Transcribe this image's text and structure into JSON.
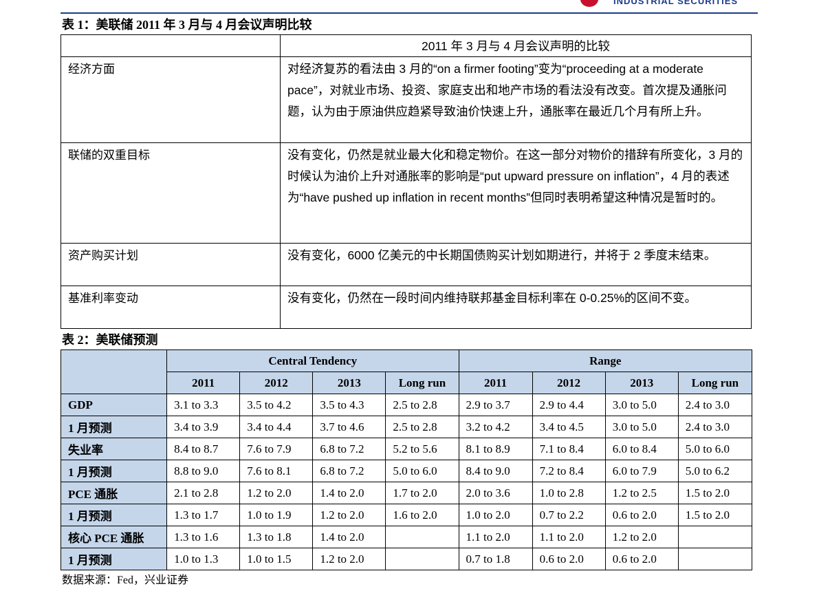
{
  "header": {
    "logo_text": "INDUSTRIAL SECURITIES"
  },
  "table1": {
    "caption": "表 1：美联储 2011 年 3 月与 4 月会议声明比较",
    "header": "2011 年 3 月与 4 月会议声明的比较",
    "rows": [
      {
        "category": "经济方面",
        "text": "对经济复苏的看法由 3 月的“on a firmer footing”变为“proceeding at a moderate pace”，对就业市场、投资、家庭支出和地产市场的看法没有改变。首次提及通胀问题，认为由于原油供应趋紧导致油价快速上升，通胀率在最近几个月有所上升。"
      },
      {
        "category": "联储的双重目标",
        "text": "没有变化，仍然是就业最大化和稳定物价。在这一部分对物价的措辞有所变化，3 月的时候认为油价上升对通胀率的影响是“put upward pressure on inflation”，4 月的表述为“have pushed up inflation in recent months”但同时表明希望这种情况是暂时的。"
      },
      {
        "category": "资产购买计划",
        "text": "没有变化，6000 亿美元的中长期国债购买计划如期进行，并将于 2 季度末结束。"
      },
      {
        "category": "基准利率变动",
        "text": "没有变化，仍然在一段时间内维持联邦基金目标利率在 0-0.25%的区间不变。"
      }
    ]
  },
  "table2": {
    "caption": "表 2：美联储预测",
    "groups": [
      "Central Tendency",
      "Range"
    ],
    "years": [
      "2011",
      "2012",
      "2013",
      "Long run",
      "2011",
      "2012",
      "2013",
      "Long run"
    ],
    "rows": [
      {
        "label": "GDP",
        "values": [
          "3.1 to 3.3",
          "3.5 to 4.2",
          "3.5 to 4.3",
          "2.5 to 2.8",
          "2.9 to 3.7",
          "2.9 to 4.4",
          "3.0 to 5.0",
          "2.4 to 3.0"
        ]
      },
      {
        "label": "1 月预测",
        "values": [
          "3.4 to 3.9",
          "3.4 to 4.4",
          "3.7 to 4.6",
          "2.5 to 2.8",
          "3.2 to 4.2",
          "3.4 to 4.5",
          "3.0 to 5.0",
          "2.4 to 3.0"
        ]
      },
      {
        "label": "失业率",
        "values": [
          "8.4 to 8.7",
          "7.6 to 7.9",
          "6.8 to 7.2",
          "5.2 to 5.6",
          "8.1 to 8.9",
          "7.1 to 8.4",
          "6.0 to 8.4",
          "5.0 to 6.0"
        ]
      },
      {
        "label": "1 月预测",
        "values": [
          "8.8 to 9.0",
          "7.6 to 8.1",
          "6.8 to 7.2",
          "5.0 to 6.0",
          "8.4 to 9.0",
          "7.2 to 8.4",
          "6.0 to 7.9",
          "5.0 to 6.2"
        ]
      },
      {
        "label": "PCE 通胀",
        "values": [
          "2.1 to 2.8",
          "1.2 to 2.0",
          "1.4 to 2.0",
          "1.7 to 2.0",
          "2.0 to 3.6",
          "1.0 to 2.8",
          "1.2 to 2.5",
          "1.5 to 2.0"
        ]
      },
      {
        "label": "1 月预测",
        "values": [
          "1.3 to 1.7",
          "1.0 to 1.9",
          "1.2 to 2.0",
          "1.6 to 2.0",
          "1.0 to 2.0",
          "0.7 to 2.2",
          "0.6 to 2.0",
          "1.5 to 2.0"
        ]
      },
      {
        "label": "核心 PCE 通胀",
        "values": [
          "1.3 to 1.6",
          "1.3 to 1.8",
          "1.4 to 2.0",
          "",
          "1.1 to 2.0",
          "1.1 to 2.0",
          "1.2 to 2.0",
          ""
        ]
      },
      {
        "label": "1 月预测",
        "values": [
          "1.0 to 1.3",
          "1.0 to 1.5",
          "1.2 to 2.0",
          "",
          "0.7 to 1.8",
          "0.6 to 2.0",
          "0.6 to 2.0",
          ""
        ]
      }
    ]
  },
  "source": "数据来源：Fed，兴业证券"
}
